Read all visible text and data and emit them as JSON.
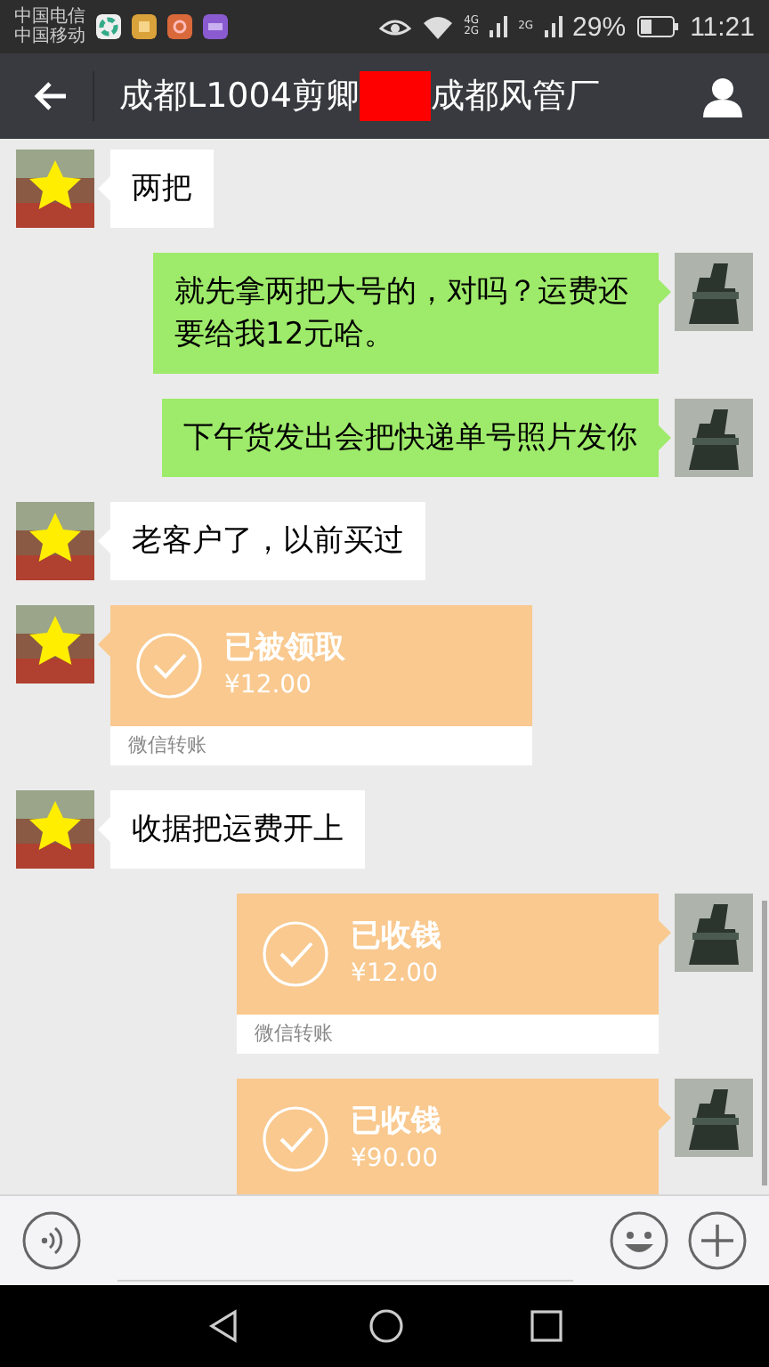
{
  "status_bar": {
    "carriers": [
      "中国电信",
      "中国移动"
    ],
    "network_labels": [
      "4G",
      "2G",
      "2G"
    ],
    "battery": "29%",
    "time": "11:21"
  },
  "header": {
    "title_start": "成都L1004剪卿",
    "title_end": "成都风管厂"
  },
  "messages": [
    {
      "outgoing": false,
      "kind": "text",
      "text": "两把"
    },
    {
      "outgoing": true,
      "kind": "text",
      "text": "就先拿两把大号的，对吗？运费还要给我12元哈。"
    },
    {
      "outgoing": true,
      "kind": "text",
      "text": "下午货发出会把快递单号照片发你"
    },
    {
      "outgoing": false,
      "kind": "text",
      "text": "老客户了，以前买过"
    },
    {
      "outgoing": false,
      "kind": "transfer",
      "status": "已被领取",
      "amount": "¥12.00",
      "footer": "微信转账"
    },
    {
      "outgoing": false,
      "kind": "text",
      "text": "收据把运费开上"
    },
    {
      "outgoing": true,
      "kind": "transfer",
      "status": "已收钱",
      "amount": "¥12.00",
      "footer": "微信转账"
    },
    {
      "outgoing": true,
      "kind": "transfer",
      "status": "已收钱",
      "amount": "¥90.00"
    }
  ]
}
